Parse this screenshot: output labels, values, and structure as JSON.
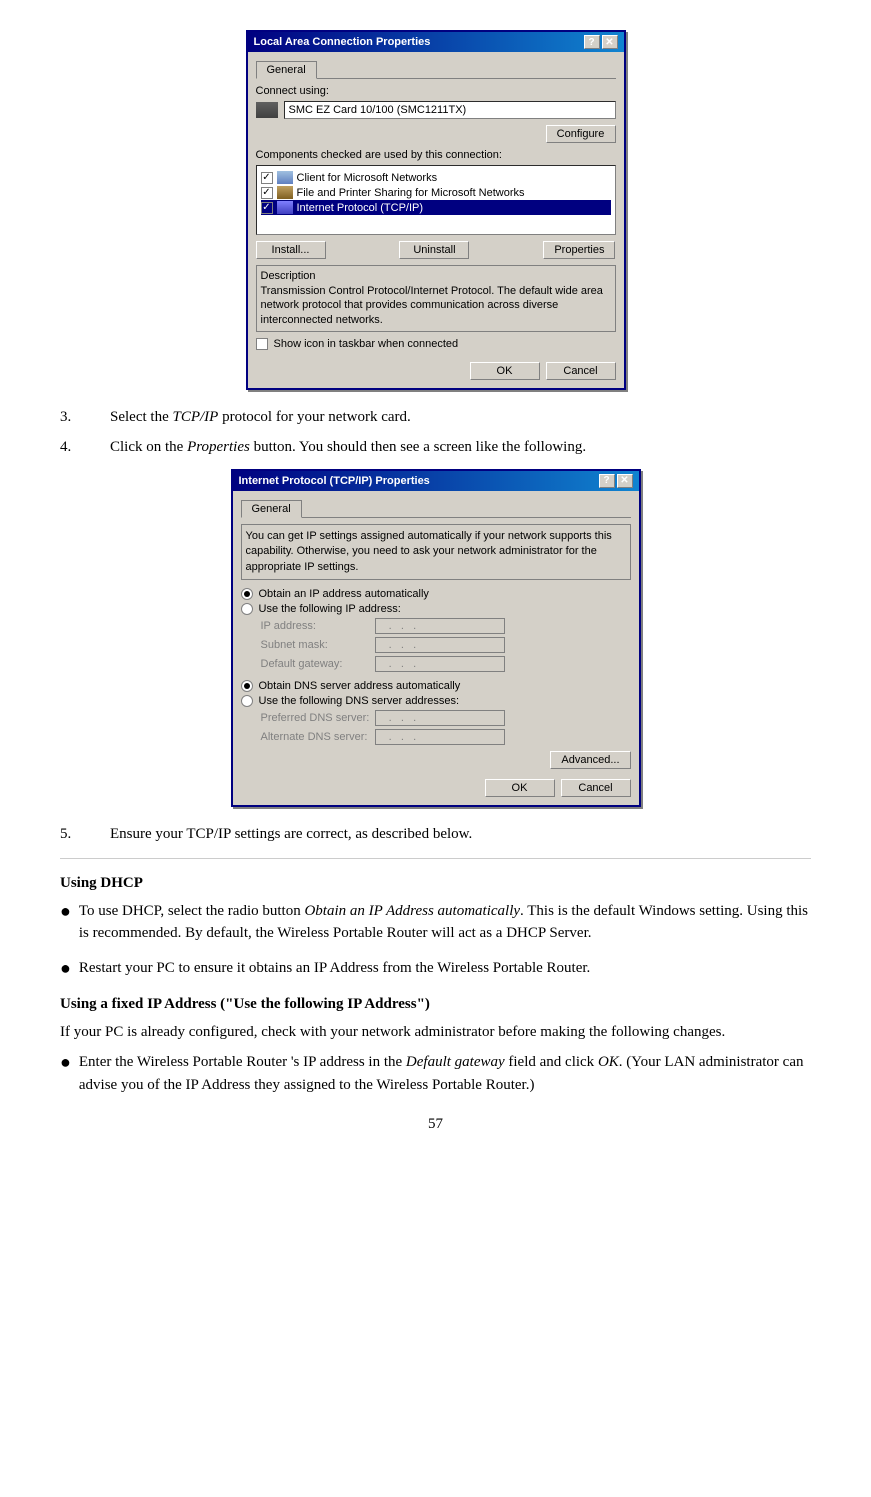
{
  "dialog1": {
    "title": "Local Area Connection Properties",
    "tab": "General",
    "connect_using_label": "Connect using:",
    "device_name": "SMC EZ Card 10/100 (SMC1211TX)",
    "configure_btn": "Configure",
    "components_label": "Components checked are used by this connection:",
    "components": [
      {
        "checked": true,
        "name": "Client for Microsoft Networks"
      },
      {
        "checked": true,
        "name": "File and Printer Sharing for Microsoft Networks"
      },
      {
        "checked": true,
        "name": "Internet Protocol (TCP/IP)",
        "selected": true
      }
    ],
    "install_btn": "Install...",
    "uninstall_btn": "Uninstall",
    "properties_btn": "Properties",
    "description_title": "Description",
    "description_text": "Transmission Control Protocol/Internet Protocol. The default wide area network protocol that provides communication across diverse interconnected networks.",
    "taskbar_checkbox": "Show icon in taskbar when connected",
    "ok_btn": "OK",
    "cancel_btn": "Cancel"
  },
  "steps": {
    "step3_num": "3.",
    "step3_text_prefix": "Select the ",
    "step3_italic": "TCP/IP",
    "step3_text_suffix": " protocol for your network card.",
    "step4_num": "4.",
    "step4_text_prefix": "Click on the ",
    "step4_italic": "Properties",
    "step4_text_suffix": " button. You should then see a screen like the following."
  },
  "dialog2": {
    "title": "Internet Protocol (TCP/IP) Properties",
    "tab": "General",
    "info_text": "You can get IP settings assigned automatically if your network supports this capability. Otherwise, you need to ask your network administrator for the appropriate IP settings.",
    "radio_auto_ip": "Obtain an IP address automatically",
    "radio_fixed_ip": "Use the following IP address:",
    "ip_address_label": "IP address:",
    "subnet_mask_label": "Subnet mask:",
    "default_gateway_label": "Default gateway:",
    "radio_auto_dns": "Obtain DNS server address automatically",
    "radio_fixed_dns": "Use the following DNS server addresses:",
    "preferred_dns_label": "Preferred DNS server:",
    "alternate_dns_label": "Alternate DNS server:",
    "advanced_btn": "Advanced...",
    "ok_btn": "OK",
    "cancel_btn": "Cancel"
  },
  "step5": {
    "num": "5.",
    "text": "Ensure your TCP/IP settings are correct, as described below."
  },
  "using_dhcp": {
    "heading": "Using DHCP",
    "bullet1_prefix": "To use DHCP, select the radio button ",
    "bullet1_italic": "Obtain an IP Address automatically",
    "bullet1_suffix": ". This is the default Windows setting. Using this is recommended. By default, the Wireless Portable Router will act as a DHCP Server.",
    "bullet2": "Restart your PC to ensure it obtains an IP Address from the Wireless Portable Router."
  },
  "using_fixed": {
    "heading": "Using a fixed IP Address (\"Use the following IP Address\")",
    "intro": "If your PC is already configured, check with your network administrator before making the following changes.",
    "bullet1_prefix": "Enter the Wireless Portable Router 's IP address in the ",
    "bullet1_italic": "Default gateway",
    "bullet1_suffix": " field and click ",
    "bullet1_italic2": "OK",
    "bullet1_end": ". (Your LAN administrator can advise you of the IP Address they assigned to the Wireless Portable Router.)"
  },
  "page_number": "57"
}
